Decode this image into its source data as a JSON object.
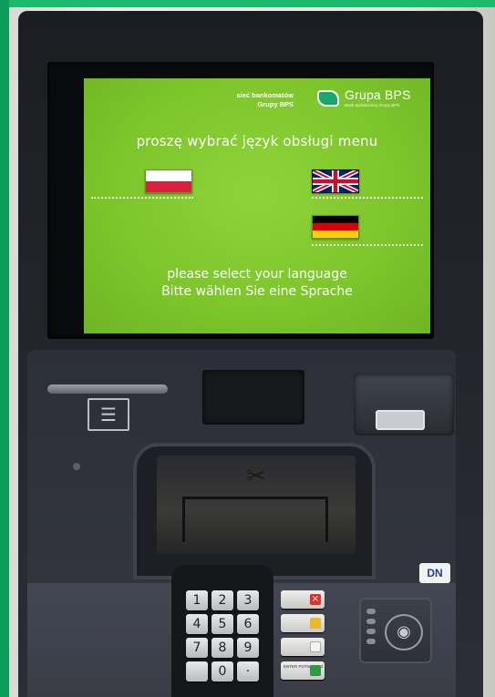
{
  "screen": {
    "network_label_line1": "sieć bankomatów",
    "network_label_line2": "Grupy BPS",
    "logo_name": "Grupa BPS",
    "logo_tagline": "Bank Spółdzielczy Grupy BPS",
    "prompt_pl": "proszę wybrać język obsługi menu",
    "prompt_en": "please select your language",
    "prompt_de": "Bitte wählen Sie eine Sprache",
    "languages": [
      {
        "code": "pl",
        "flag": "polish-flag"
      },
      {
        "code": "en",
        "flag": "uk-flag"
      },
      {
        "code": "de",
        "flag": "german-flag"
      }
    ],
    "background_color": "#7cc52b"
  },
  "keypad": {
    "keys": [
      "1",
      "2",
      "3",
      "4",
      "5",
      "6",
      "7",
      "8",
      "9",
      "",
      "0",
      "·"
    ],
    "function_keys": [
      {
        "name": "cancel",
        "label": "",
        "color": "#d6352e",
        "symbol": "×"
      },
      {
        "name": "clear",
        "label": "",
        "color": "#e8b92a",
        "symbol": ""
      },
      {
        "name": "blank",
        "label": "",
        "color": "#f4f4f4",
        "symbol": ""
      },
      {
        "name": "enter",
        "label": "ENTER POTWIERDŹ",
        "color": "#2e9a46",
        "symbol": ""
      }
    ]
  },
  "hardware": {
    "manufacturer_logo": "DN",
    "icons": [
      "receipt-icon",
      "no-cash-icon",
      "contactless-icon",
      "card-slot"
    ]
  }
}
